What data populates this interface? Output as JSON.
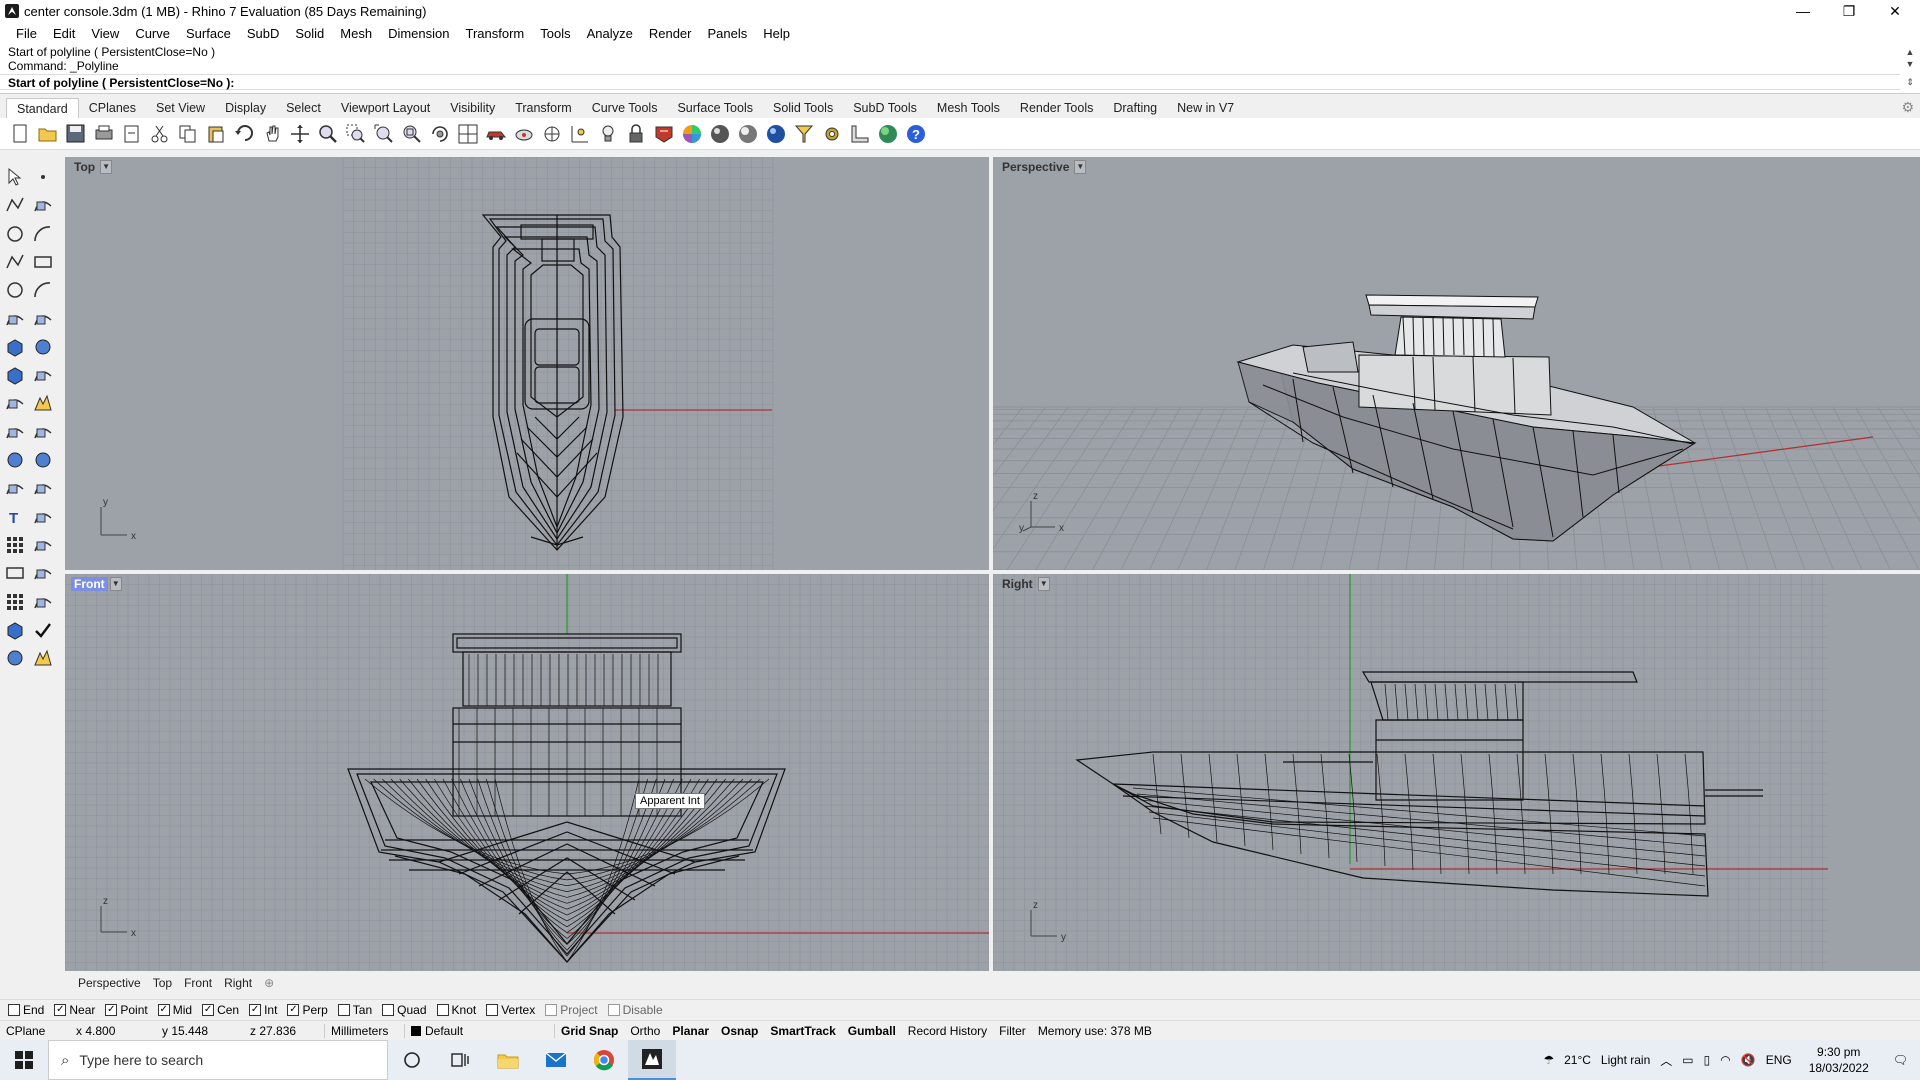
{
  "window": {
    "title": "center console.3dm (1 MB) - Rhino 7 Evaluation (85 Days Remaining)",
    "minimize": "—",
    "restore": "❐",
    "close": "✕"
  },
  "menu": [
    "File",
    "Edit",
    "View",
    "Curve",
    "Surface",
    "SubD",
    "Solid",
    "Mesh",
    "Dimension",
    "Transform",
    "Tools",
    "Analyze",
    "Render",
    "Panels",
    "Help"
  ],
  "command": {
    "history_1": "Start of polyline ( PersistentClose=No )",
    "history_2": "Command: _Polyline",
    "prompt": "Start of polyline ( PersistentClose=No ):"
  },
  "toolbar_tabs": [
    "Standard",
    "CPlanes",
    "Set View",
    "Display",
    "Select",
    "Viewport Layout",
    "Visibility",
    "Transform",
    "Curve Tools",
    "Surface Tools",
    "Solid Tools",
    "SubD Tools",
    "Mesh Tools",
    "Render Tools",
    "Drafting",
    "New in V7"
  ],
  "standard_icons": [
    "new-icon",
    "open-icon",
    "save-icon",
    "print-icon",
    "import-icon",
    "cut-icon",
    "copy-icon",
    "paste-icon",
    "undo-icon",
    "pan-icon",
    "move-view-icon",
    "zoom-icon",
    "zoom-window-icon",
    "zoom-extents-icon",
    "zoom-selected-icon",
    "rotate-view-icon",
    "four-viewports-icon",
    "car-icon",
    "object-snap-icon",
    "grid-icon",
    "coordinates-icon",
    "light-icon",
    "lock-icon",
    "material-icon",
    "color-wheel-icon",
    "render-sphere-icon",
    "shaded-sphere-icon",
    "blue-sphere-icon",
    "filter-icon",
    "options-gear-icon",
    "measure-icon",
    "globe-icon",
    "help-icon"
  ],
  "viewports": {
    "top": "Top",
    "perspective": "Perspective",
    "front": "Front",
    "right": "Right",
    "tooltip": "Apparent Int"
  },
  "axis": {
    "x": "x",
    "y": "y",
    "z": "z"
  },
  "viewport_tabs": [
    "Perspective",
    "Top",
    "Front",
    "Right"
  ],
  "viewport_tab_add": "⊕",
  "osnaps": [
    {
      "label": "End",
      "checked": false
    },
    {
      "label": "Near",
      "checked": true
    },
    {
      "label": "Point",
      "checked": true
    },
    {
      "label": "Mid",
      "checked": true
    },
    {
      "label": "Cen",
      "checked": true
    },
    {
      "label": "Int",
      "checked": true
    },
    {
      "label": "Perp",
      "checked": true
    },
    {
      "label": "Tan",
      "checked": false
    },
    {
      "label": "Quad",
      "checked": false
    },
    {
      "label": "Knot",
      "checked": false
    },
    {
      "label": "Vertex",
      "checked": false
    },
    {
      "label": "Project",
      "checked": false
    },
    {
      "label": "Disable",
      "checked": false
    }
  ],
  "status": {
    "cplane": "CPlane",
    "x": "x 4.800",
    "y": "y 15.448",
    "z": "z 27.836",
    "units": "Millimeters",
    "layer": "Default",
    "grid_snap": "Grid Snap",
    "ortho": "Ortho",
    "planar": "Planar",
    "osnap": "Osnap",
    "smarttrack": "SmartTrack",
    "gumball": "Gumball",
    "record_history": "Record History",
    "filter": "Filter",
    "memory": "Memory use: 378 MB"
  },
  "taskbar": {
    "search_placeholder": "Type here to search",
    "weather_temp": "21°C",
    "weather_desc": "Light rain",
    "language": "ENG",
    "time": "9:30 pm",
    "date": "18/03/2022"
  },
  "colors": {
    "viewport_bg": "#9da1a8",
    "grid_line": "#8a8e95",
    "x_axis": "#b03030",
    "y_axis": "#2a9a2a",
    "active_label": "#7b8ee0"
  }
}
